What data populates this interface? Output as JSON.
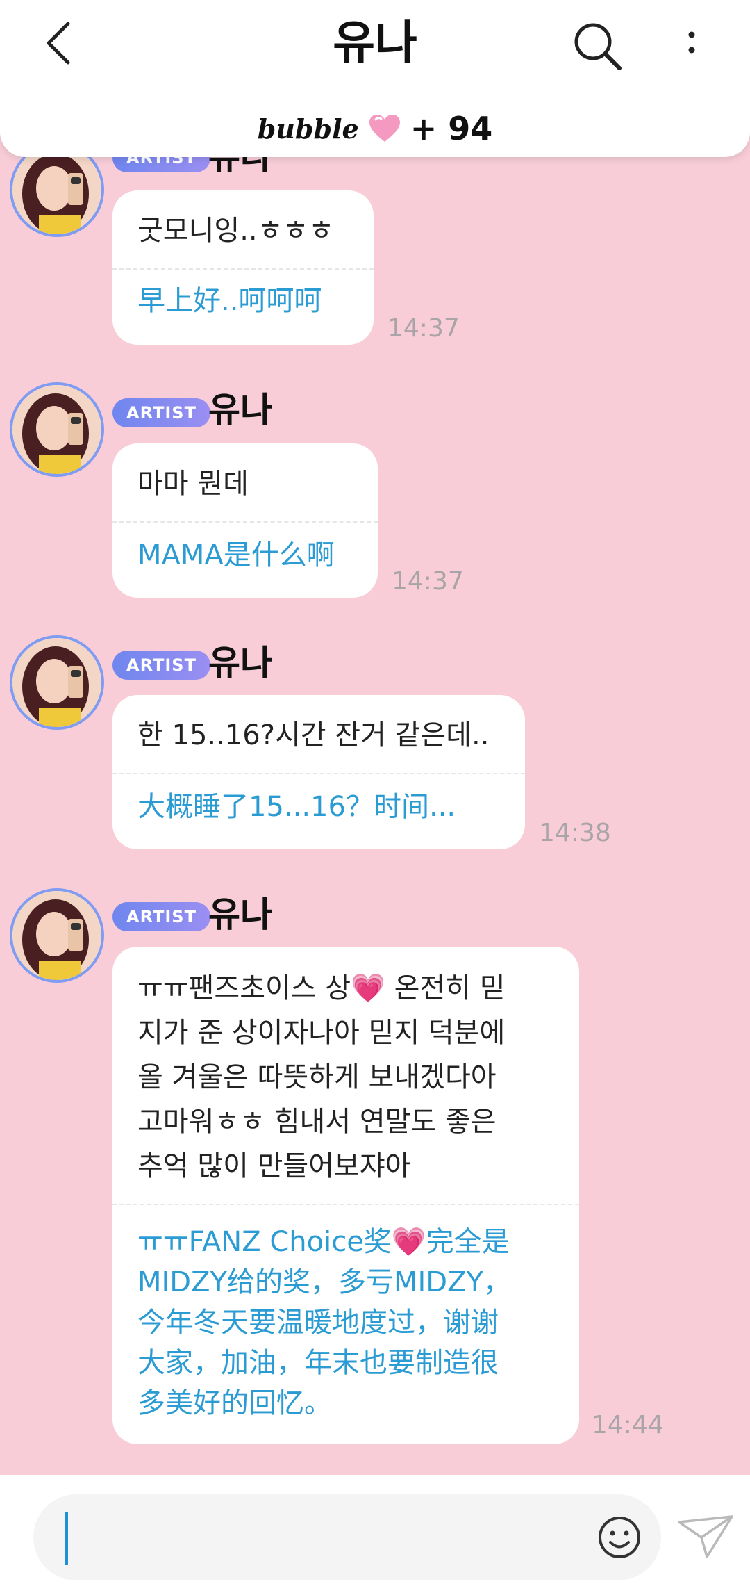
{
  "header": {
    "title": "유나",
    "bubble_logo": "bubble",
    "bubble_count": "+ 94",
    "icons": {
      "back": "chevron-left-icon",
      "search": "search-icon",
      "more": "more-vertical-icon",
      "heart": "pink-heart-icon"
    }
  },
  "messages": [
    {
      "badge": "ARTIST",
      "sender": "유나",
      "original": "굿모니잉..ㅎㅎㅎ",
      "translation": "早上好..呵呵呵",
      "time": "14:37"
    },
    {
      "badge": "ARTIST",
      "sender": "유나",
      "original": "마마 뭔데",
      "translation": "MAMA是什么啊",
      "time": "14:37"
    },
    {
      "badge": "ARTIST",
      "sender": "유나",
      "original": "한 15..16?시간 잔거 같은데..",
      "translation": "大概睡了15...16？时间...",
      "time": "14:38"
    },
    {
      "badge": "ARTIST",
      "sender": "유나",
      "original": "ㅠㅠ팬즈초이스 상💗 온전히 믿\n지가 준 상이자나아 믿지 덕분에\n올 겨울은 따뜻하게 보내겠다아\n고마워ㅎㅎ 힘내서 연말도 좋은\n추억 많이 만들어보쟈아",
      "translation": "ㅠㅠFANZ Choice奖💗完全是\nMIDZY给的奖，多亏MIDZY，\n今年冬天要温暖地度过，谢谢\n大家，加油，年末也要制造很\n多美好的回忆。",
      "time": "14:44"
    }
  ],
  "input": {
    "value": "",
    "icons": {
      "emoji": "smiley-icon",
      "send": "paper-plane-icon"
    }
  },
  "colors": {
    "background": "#f8cdd8",
    "translation_text": "#2b9bd3",
    "badge": "#7f8ff0",
    "timestamp": "#a9a4a8"
  }
}
